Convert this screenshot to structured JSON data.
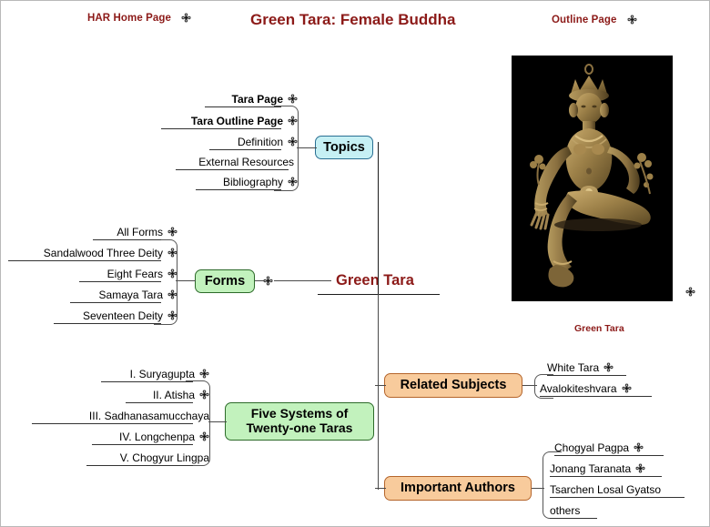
{
  "header": {
    "home_link": "HAR Home Page",
    "title": "Green Tara: Female Buddha",
    "outline_link": "Outline Page",
    "link_icon": "flower-link-icon",
    "accent_color": "#8c1a18"
  },
  "mindmap": {
    "center": {
      "label": "Green Tara"
    },
    "branches": [
      {
        "id": "topics",
        "label": "Topics",
        "color": "#c6f0f4",
        "border_color": "#2a6f93",
        "side": "left",
        "items": [
          {
            "label": "Tara Page",
            "bold": true,
            "icon": true
          },
          {
            "label": "Tara Outline Page",
            "bold": true,
            "icon": true
          },
          {
            "label": "Definition",
            "bold": false,
            "icon": true
          },
          {
            "label": "External Resources",
            "bold": false,
            "icon": false
          },
          {
            "label": "Bibliography",
            "bold": false,
            "icon": true
          }
        ]
      },
      {
        "id": "forms",
        "label": "Forms",
        "color": "#c2f2bd",
        "border_color": "#2d6b2a",
        "side": "left",
        "items": [
          {
            "label": "All Forms",
            "bold": false,
            "icon": true
          },
          {
            "label": "Sandalwood Three Deity",
            "bold": false,
            "icon": true
          },
          {
            "label": "Eight Fears",
            "bold": false,
            "icon": true
          },
          {
            "label": "Samaya Tara",
            "bold": false,
            "icon": true
          },
          {
            "label": "Seventeen Deity",
            "bold": false,
            "icon": true
          }
        ]
      },
      {
        "id": "five-systems",
        "label": "Five Systems of Twenty-one Taras",
        "label_line1": "Five Systems of",
        "label_line2": "Twenty-one Taras",
        "color": "#c2f2bd",
        "border_color": "#2d6b2a",
        "side": "left",
        "items": [
          {
            "label": "I.  Suryagupta",
            "bold": false,
            "icon": true
          },
          {
            "label": "II.  Atisha",
            "bold": false,
            "icon": true
          },
          {
            "label": "III.  Sadhanasamucchaya",
            "bold": false,
            "icon": false
          },
          {
            "label": "IV.  Longchenpa",
            "bold": false,
            "icon": true
          },
          {
            "label": "V.  Chogyur Lingpa",
            "bold": false,
            "icon": false
          }
        ]
      },
      {
        "id": "related-subjects",
        "label": "Related Subjects",
        "color": "#f8cb9c",
        "border_color": "#b5652b",
        "side": "right",
        "items": [
          {
            "label": "White Tara",
            "bold": false,
            "icon": true
          },
          {
            "label": "Avalokiteshvara",
            "bold": false,
            "icon": true
          }
        ]
      },
      {
        "id": "important-authors",
        "label": "Important Authors",
        "color": "#f8cb9c",
        "border_color": "#b5652b",
        "side": "right",
        "items": [
          {
            "label": "Chogyal Pagpa",
            "bold": false,
            "icon": true
          },
          {
            "label": "Jonang Taranata",
            "bold": false,
            "icon": true
          },
          {
            "label": "Tsarchen Losal Gyatso",
            "bold": false,
            "icon": false
          },
          {
            "label": "others",
            "bold": false,
            "icon": false
          }
        ]
      }
    ]
  },
  "photo": {
    "caption": "Green Tara",
    "alt": "Gilt bronze seated Green Tara statue on black background",
    "side_icon": "flower-link-icon"
  }
}
